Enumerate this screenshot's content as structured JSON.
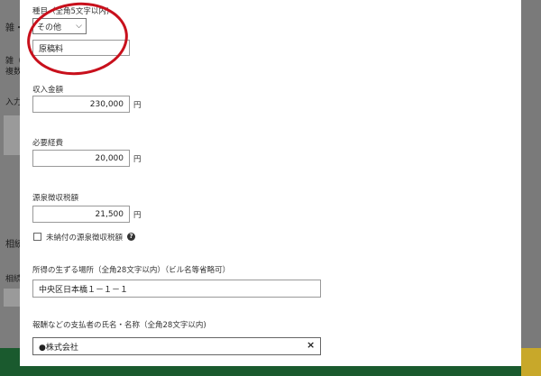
{
  "background": {
    "heading": "雑・",
    "line1": "雑（",
    "line2": "複数",
    "line3": "入力",
    "section": "相続",
    "line4": "相続"
  },
  "form": {
    "category_label": "種目（全角5文字以内)",
    "category_select": "その他",
    "category_value": "原稿料",
    "income_label": "収入金額",
    "income_value": "230,000",
    "expense_label": "必要経費",
    "expense_value": "20,000",
    "withholding_label": "源泉徴収税額",
    "withholding_value": "21,500",
    "unit": "円",
    "unpaid_checkbox_label": "未納付の源泉徴収税額",
    "help_glyph": "?",
    "location_label": "所得の生ずる場所（全角28文字以内）（ビル名等省略可）",
    "location_value": "中央区日本橋１－１－１",
    "payer_label": "報酬などの支払者の氏名・名称（全角28文字以内)",
    "payer_value": "●株式会社",
    "clear_glyph": "×"
  },
  "annotation": {
    "circle_color": "#c8101c"
  }
}
